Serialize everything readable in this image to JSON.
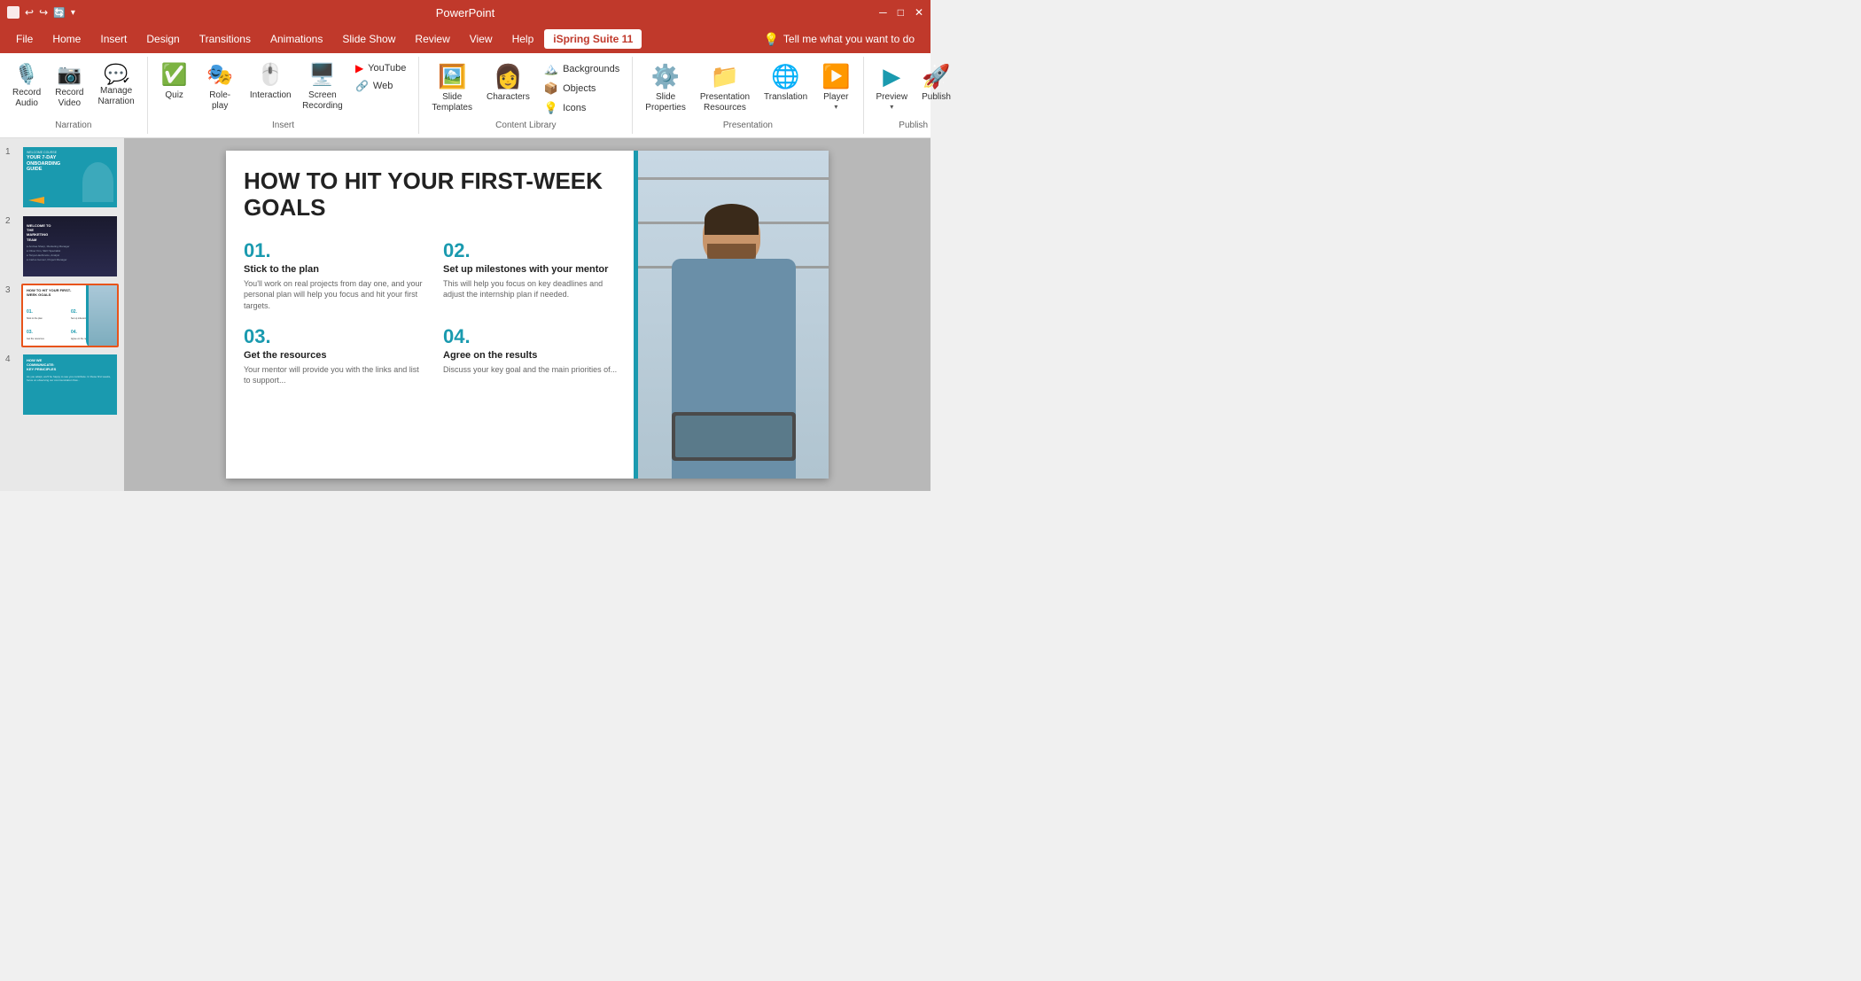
{
  "app": {
    "title": "PowerPoint",
    "title_bar_buttons": [
      "minimize",
      "maximize",
      "close"
    ]
  },
  "menu": {
    "items": [
      {
        "label": "File",
        "active": false
      },
      {
        "label": "Home",
        "active": false
      },
      {
        "label": "Insert",
        "active": false
      },
      {
        "label": "Design",
        "active": false
      },
      {
        "label": "Transitions",
        "active": false
      },
      {
        "label": "Animations",
        "active": false
      },
      {
        "label": "Slide Show",
        "active": false
      },
      {
        "label": "Review",
        "active": false
      },
      {
        "label": "View",
        "active": false
      },
      {
        "label": "Help",
        "active": false
      },
      {
        "label": "iSpring Suite 11",
        "active": true
      }
    ],
    "tell_me": "Tell me what you want to do"
  },
  "ribbon": {
    "groups": [
      {
        "name": "Narration",
        "items": [
          {
            "type": "large",
            "icon": "🎙️",
            "label": "Record\nAudio"
          },
          {
            "type": "large",
            "icon": "🎥",
            "label": "Record\nVideo"
          },
          {
            "type": "large",
            "icon": "💬",
            "label": "Manage\nNarration"
          }
        ]
      },
      {
        "name": "Insert",
        "items": [
          {
            "type": "large",
            "icon": "📝",
            "label": "Quiz"
          },
          {
            "type": "large",
            "icon": "🎭",
            "label": "Role-play"
          },
          {
            "type": "large",
            "icon": "🖱️",
            "label": "Interaction"
          },
          {
            "type": "large",
            "icon": "🖥️",
            "label": "Screen\nRecording"
          },
          {
            "type": "col",
            "rows": [
              {
                "icon": "▶️",
                "label": "YouTube",
                "color": "red"
              },
              {
                "icon": "🔗",
                "label": "Web",
                "color": "teal"
              }
            ]
          }
        ]
      },
      {
        "name": "Content Library",
        "items": [
          {
            "type": "large",
            "icon": "🖼️",
            "label": "Slide\nTemplates"
          },
          {
            "type": "large",
            "icon": "👤",
            "label": "Characters"
          },
          {
            "type": "col",
            "rows": [
              {
                "icon": "🖼️",
                "label": "Backgrounds"
              },
              {
                "icon": "📦",
                "label": "Objects"
              },
              {
                "icon": "💡",
                "label": "Icons"
              }
            ]
          }
        ]
      },
      {
        "name": "Presentation",
        "items": [
          {
            "type": "large",
            "icon": "⚙️",
            "label": "Slide\nProperties"
          },
          {
            "type": "large",
            "icon": "📁",
            "label": "Presentation\nResources"
          },
          {
            "type": "large",
            "icon": "🌐",
            "label": "Translation"
          },
          {
            "type": "large",
            "icon": "▶️",
            "label": "Player"
          }
        ]
      },
      {
        "name": "Publish",
        "items": [
          {
            "type": "large",
            "icon": "👁️",
            "label": "Preview"
          },
          {
            "type": "large",
            "icon": "🚀",
            "label": "Publish"
          }
        ]
      }
    ]
  },
  "slides": [
    {
      "num": "1",
      "type": "onboarding",
      "title": "YOUR 7-DAY ONBOARDING GUIDE",
      "subtitle": "WELCOME COURSE"
    },
    {
      "num": "2",
      "type": "team",
      "title": "WELCOME TO THE MARKETING TEAM"
    },
    {
      "num": "3",
      "type": "goals",
      "title": "HOW TO HIT YOUR FIRST-WEEK GOALS",
      "selected": true
    },
    {
      "num": "4",
      "type": "communicate",
      "title": "HOW WE COMMUNICATE: KEY PRINCIPLES"
    }
  ],
  "main_slide": {
    "title": "HOW TO HIT YOUR FIRST-WEEK GOALS",
    "items": [
      {
        "num": "01.",
        "title": "Stick to the plan",
        "desc": "You'll work on real projects from day one, and your personal plan will help you focus and hit your first targets."
      },
      {
        "num": "02.",
        "title": "Set up milestones with your mentor",
        "desc": "This will help you focus on key deadlines and adjust the internship plan if needed."
      },
      {
        "num": "03.",
        "title": "Get the resources",
        "desc": "Your mentor will provide you with the links and list to support..."
      },
      {
        "num": "04.",
        "title": "Agree on the results",
        "desc": "Discuss your key goal and the main priorities of..."
      }
    ]
  },
  "colors": {
    "toolbar_bg": "#c0392b",
    "teal": "#1a9aaf",
    "selected_border": "#e8541a"
  }
}
